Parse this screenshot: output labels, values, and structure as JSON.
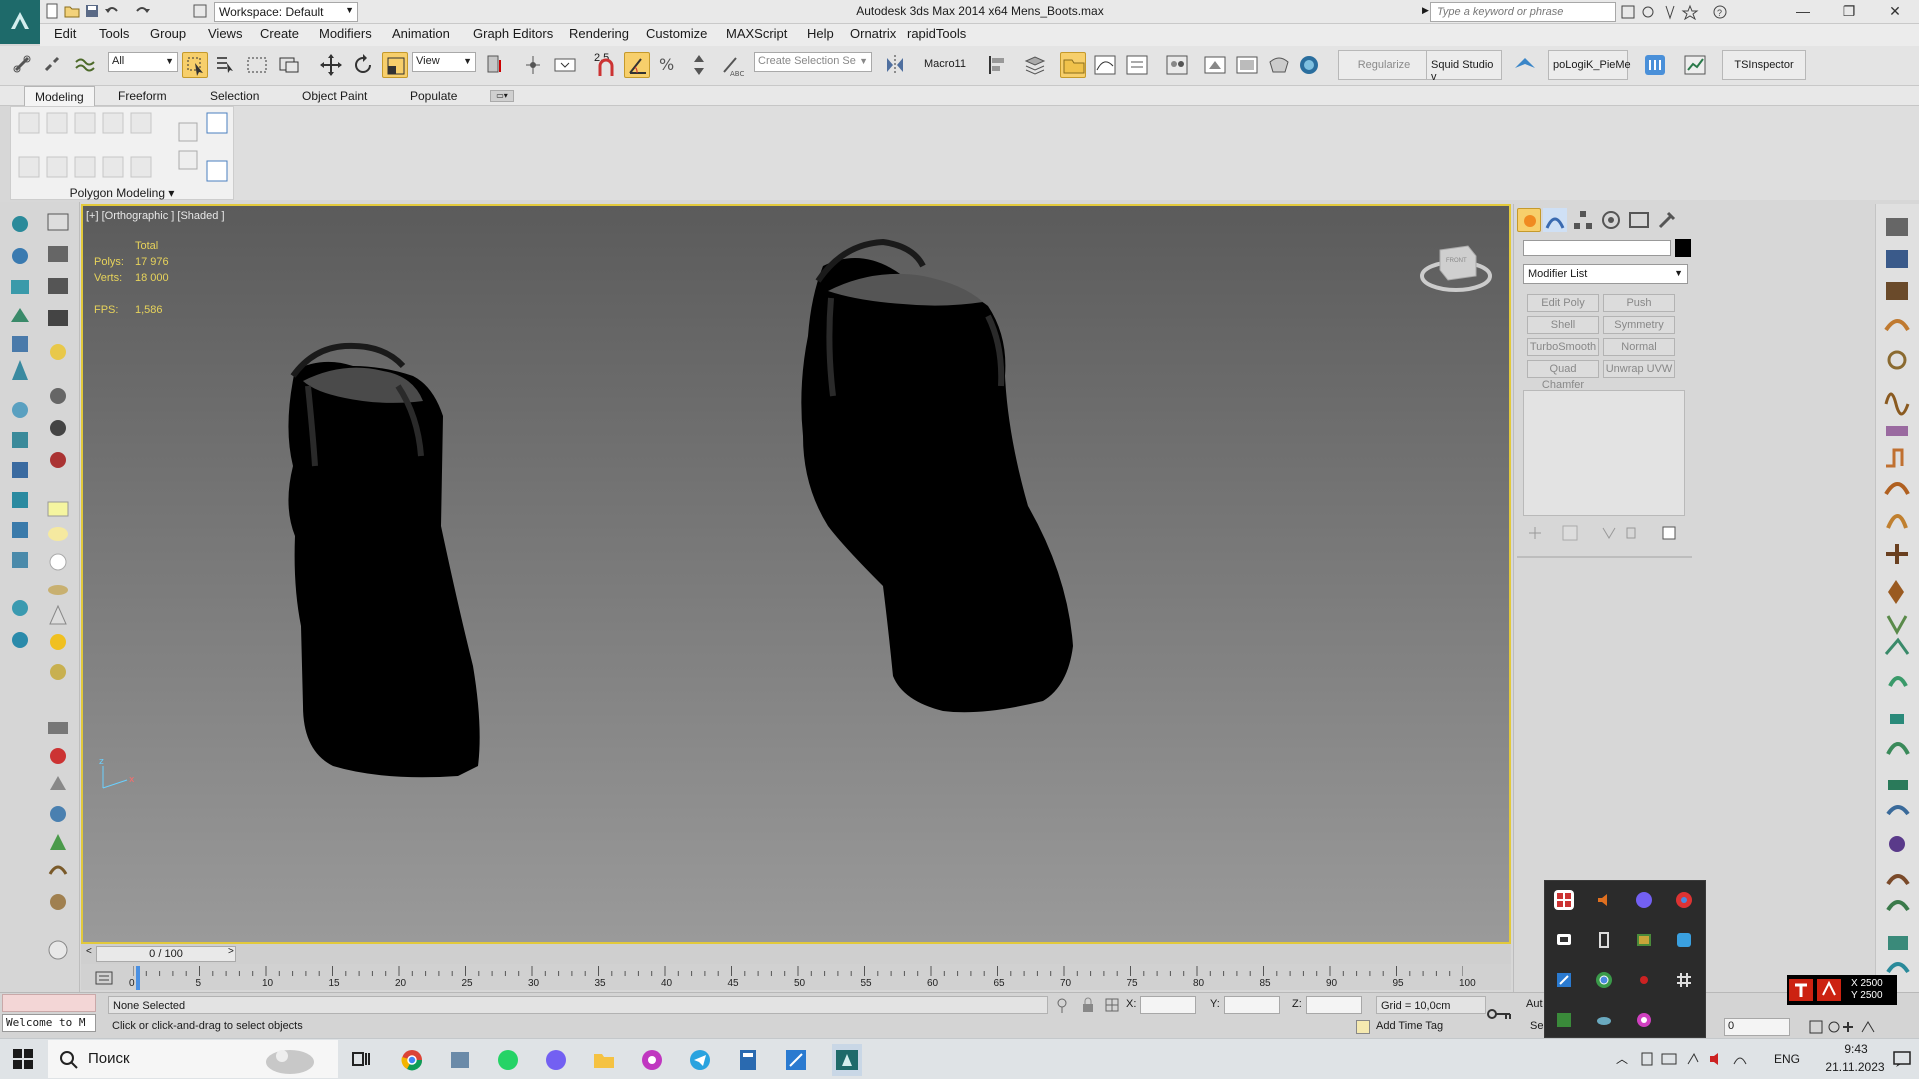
{
  "titlebar": {
    "workspace": "Workspace: Default",
    "app_title": "Autodesk 3ds Max  2014 x64     Mens_Boots.max",
    "search_placeholder": "Type a keyword or phrase"
  },
  "menu": [
    "Edit",
    "Tools",
    "Group",
    "Views",
    "Create",
    "Modifiers",
    "Animation",
    "Graph Editors",
    "Rendering",
    "Customize",
    "MAXScript",
    "Help",
    "Ornatrix",
    "rapidTools"
  ],
  "toolbar": {
    "filter_value": "All",
    "refcoord_value": "View",
    "snap_value": "2.5",
    "selection_set_placeholder": "Create Selection Se",
    "macro_label": "Macro11",
    "regularize_label": "Regularize",
    "squid_label": "Squid Studio v",
    "pielogik_label": "poLogiK_PieMe",
    "tsinspector_label": "TSInspector"
  },
  "ribbon": {
    "tabs": [
      "Modeling",
      "Freeform",
      "Selection",
      "Object Paint",
      "Populate"
    ],
    "panel_label": "Polygon Modeling"
  },
  "viewport": {
    "label": "[+] [Orthographic ] [Shaded ]",
    "stats_total": "Total",
    "polys_label": "Polys:",
    "polys_value": "17 976",
    "verts_label": "Verts:",
    "verts_value": "18 000",
    "fps_label": "FPS:",
    "fps_value": "1,586",
    "viewcube_label": "FRONT"
  },
  "command_panel": {
    "modifier_list": "Modifier List",
    "buttons": [
      "Edit Poly",
      "Push",
      "Shell",
      "Symmetry",
      "TurboSmooth",
      "Normal",
      "Quad Chamfer",
      "Unwrap UVW"
    ]
  },
  "timeline": {
    "slider": "0 / 100",
    "ticks": [
      "0",
      "5",
      "10",
      "15",
      "20",
      "25",
      "30",
      "35",
      "40",
      "45",
      "50",
      "55",
      "60",
      "65",
      "70",
      "75",
      "80",
      "85",
      "90",
      "95",
      "100"
    ]
  },
  "status": {
    "listener": "Welcome to M",
    "selection": "None Selected",
    "prompt": "Click or click-and-drag to select objects",
    "x_label": "X:",
    "y_label": "Y:",
    "z_label": "Z:",
    "grid": "Grid = 10,0cm",
    "add_time_tag": "Add Time Tag",
    "auto_key": "Aut",
    "set_key": "Se",
    "frame": "0"
  },
  "badge": {
    "x": "X 2500",
    "y": "Y 2500"
  },
  "taskbar": {
    "search": "Поиск",
    "lang": "ENG",
    "time": "9:43",
    "date": "21.11.2023"
  },
  "colors": {
    "accent": "#f7cf6b",
    "viewport_border": "#e2c93b",
    "stats": "#e7d35b"
  }
}
